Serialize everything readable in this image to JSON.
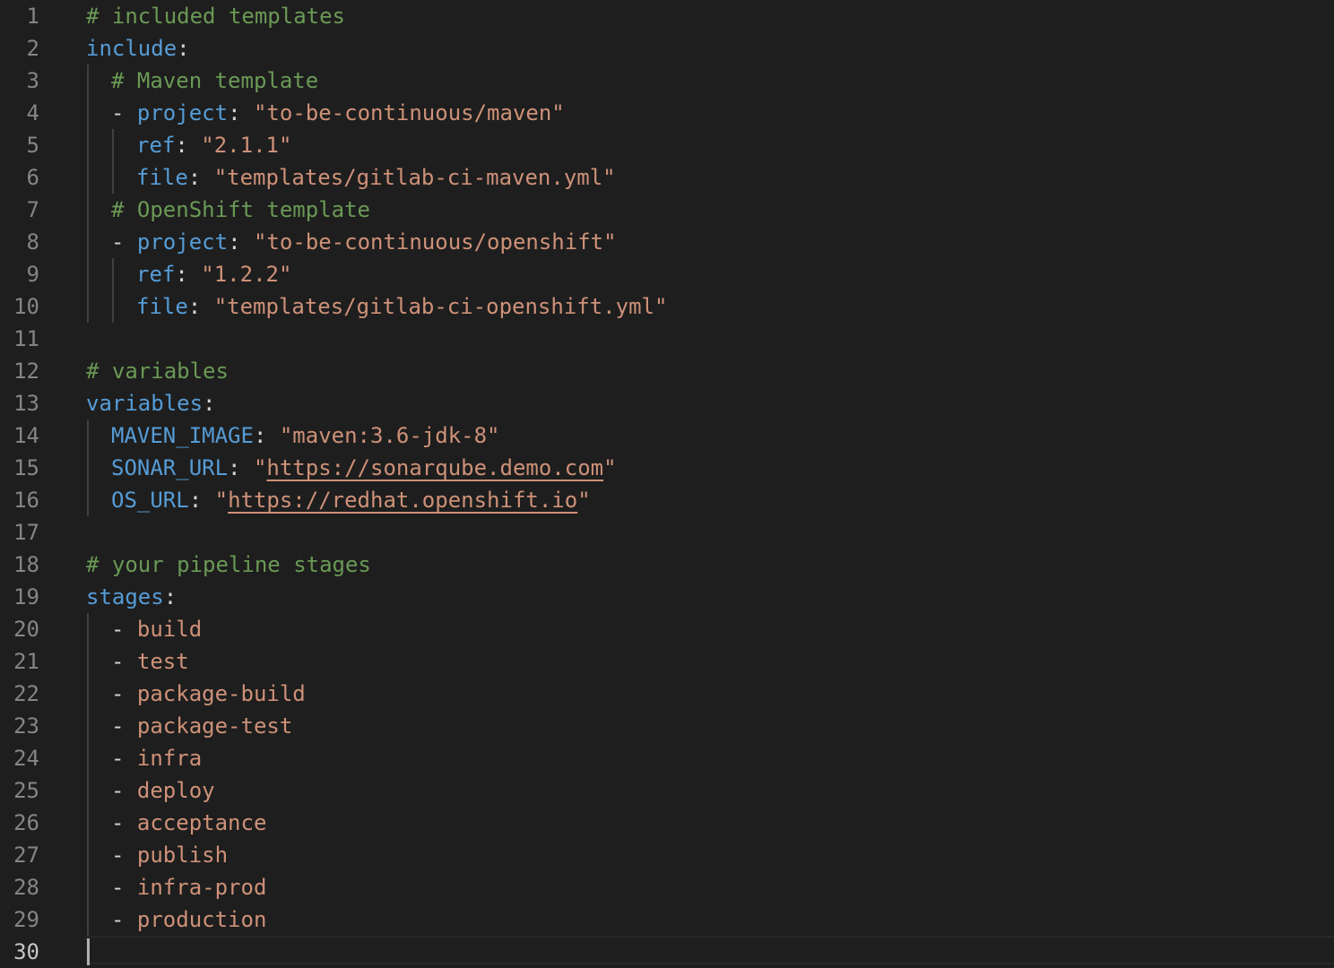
{
  "editor": {
    "colors": {
      "background": "#1e1e1e",
      "comment": "#6a9955",
      "key": "#569cd6",
      "string": "#ce9178",
      "punctuation": "#d4d4d4",
      "line_number": "#858585",
      "active_line_number": "#c6c6c6"
    },
    "lines": [
      {
        "n": "1",
        "indent": 0,
        "tokens": [
          {
            "t": "# included templates",
            "c": "cmt"
          }
        ]
      },
      {
        "n": "2",
        "indent": 0,
        "tokens": [
          {
            "t": "include",
            "c": "key"
          },
          {
            "t": ":",
            "c": "punc"
          }
        ]
      },
      {
        "n": "3",
        "indent": 1,
        "tokens": [
          {
            "t": "# Maven template",
            "c": "cmt"
          }
        ]
      },
      {
        "n": "4",
        "indent": 1,
        "tokens": [
          {
            "t": "- ",
            "c": "punc"
          },
          {
            "t": "project",
            "c": "key"
          },
          {
            "t": ": ",
            "c": "punc"
          },
          {
            "t": "\"to-be-continuous/maven\"",
            "c": "str"
          }
        ]
      },
      {
        "n": "5",
        "indent": 2,
        "tokens": [
          {
            "t": "ref",
            "c": "key"
          },
          {
            "t": ": ",
            "c": "punc"
          },
          {
            "t": "\"2.1.1\"",
            "c": "str"
          }
        ]
      },
      {
        "n": "6",
        "indent": 2,
        "tokens": [
          {
            "t": "file",
            "c": "key"
          },
          {
            "t": ": ",
            "c": "punc"
          },
          {
            "t": "\"templates/gitlab-ci-maven.yml\"",
            "c": "str"
          }
        ]
      },
      {
        "n": "7",
        "indent": 1,
        "tokens": [
          {
            "t": "# OpenShift template",
            "c": "cmt"
          }
        ]
      },
      {
        "n": "8",
        "indent": 1,
        "tokens": [
          {
            "t": "- ",
            "c": "punc"
          },
          {
            "t": "project",
            "c": "key"
          },
          {
            "t": ": ",
            "c": "punc"
          },
          {
            "t": "\"to-be-continuous/openshift\"",
            "c": "str"
          }
        ]
      },
      {
        "n": "9",
        "indent": 2,
        "tokens": [
          {
            "t": "ref",
            "c": "key"
          },
          {
            "t": ": ",
            "c": "punc"
          },
          {
            "t": "\"1.2.2\"",
            "c": "str"
          }
        ]
      },
      {
        "n": "10",
        "indent": 2,
        "tokens": [
          {
            "t": "file",
            "c": "key"
          },
          {
            "t": ": ",
            "c": "punc"
          },
          {
            "t": "\"templates/gitlab-ci-openshift.yml\"",
            "c": "str"
          }
        ]
      },
      {
        "n": "11",
        "indent": 0,
        "tokens": []
      },
      {
        "n": "12",
        "indent": 0,
        "tokens": [
          {
            "t": "# variables",
            "c": "cmt"
          }
        ]
      },
      {
        "n": "13",
        "indent": 0,
        "tokens": [
          {
            "t": "variables",
            "c": "key"
          },
          {
            "t": ":",
            "c": "punc"
          }
        ]
      },
      {
        "n": "14",
        "indent": 1,
        "tokens": [
          {
            "t": "MAVEN_IMAGE",
            "c": "key"
          },
          {
            "t": ": ",
            "c": "punc"
          },
          {
            "t": "\"maven:3.6-jdk-8\"",
            "c": "str"
          }
        ]
      },
      {
        "n": "15",
        "indent": 1,
        "tokens": [
          {
            "t": "SONAR_URL",
            "c": "key"
          },
          {
            "t": ": ",
            "c": "punc"
          },
          {
            "t": "\"",
            "c": "str"
          },
          {
            "t": "https://sonarqube.demo.com",
            "c": "url"
          },
          {
            "t": "\"",
            "c": "str"
          }
        ]
      },
      {
        "n": "16",
        "indent": 1,
        "tokens": [
          {
            "t": "OS_URL",
            "c": "key"
          },
          {
            "t": ": ",
            "c": "punc"
          },
          {
            "t": "\"",
            "c": "str"
          },
          {
            "t": "https://redhat.openshift.io",
            "c": "url"
          },
          {
            "t": "\"",
            "c": "str"
          }
        ]
      },
      {
        "n": "17",
        "indent": 0,
        "tokens": []
      },
      {
        "n": "18",
        "indent": 0,
        "tokens": [
          {
            "t": "# your pipeline stages",
            "c": "cmt"
          }
        ]
      },
      {
        "n": "19",
        "indent": 0,
        "tokens": [
          {
            "t": "stages",
            "c": "key"
          },
          {
            "t": ":",
            "c": "punc"
          }
        ]
      },
      {
        "n": "20",
        "indent": 1,
        "tokens": [
          {
            "t": "- ",
            "c": "punc"
          },
          {
            "t": "build",
            "c": "str"
          }
        ]
      },
      {
        "n": "21",
        "indent": 1,
        "tokens": [
          {
            "t": "- ",
            "c": "punc"
          },
          {
            "t": "test",
            "c": "str"
          }
        ]
      },
      {
        "n": "22",
        "indent": 1,
        "tokens": [
          {
            "t": "- ",
            "c": "punc"
          },
          {
            "t": "package-build",
            "c": "str"
          }
        ]
      },
      {
        "n": "23",
        "indent": 1,
        "tokens": [
          {
            "t": "- ",
            "c": "punc"
          },
          {
            "t": "package-test",
            "c": "str"
          }
        ]
      },
      {
        "n": "24",
        "indent": 1,
        "tokens": [
          {
            "t": "- ",
            "c": "punc"
          },
          {
            "t": "infra",
            "c": "str"
          }
        ]
      },
      {
        "n": "25",
        "indent": 1,
        "tokens": [
          {
            "t": "- ",
            "c": "punc"
          },
          {
            "t": "deploy",
            "c": "str"
          }
        ]
      },
      {
        "n": "26",
        "indent": 1,
        "tokens": [
          {
            "t": "- ",
            "c": "punc"
          },
          {
            "t": "acceptance",
            "c": "str"
          }
        ]
      },
      {
        "n": "27",
        "indent": 1,
        "tokens": [
          {
            "t": "- ",
            "c": "punc"
          },
          {
            "t": "publish",
            "c": "str"
          }
        ]
      },
      {
        "n": "28",
        "indent": 1,
        "tokens": [
          {
            "t": "- ",
            "c": "punc"
          },
          {
            "t": "infra-prod",
            "c": "str"
          }
        ]
      },
      {
        "n": "29",
        "indent": 1,
        "tokens": [
          {
            "t": "- ",
            "c": "punc"
          },
          {
            "t": "production",
            "c": "str"
          }
        ]
      },
      {
        "n": "30",
        "indent": 0,
        "tokens": [],
        "active": true
      }
    ]
  }
}
